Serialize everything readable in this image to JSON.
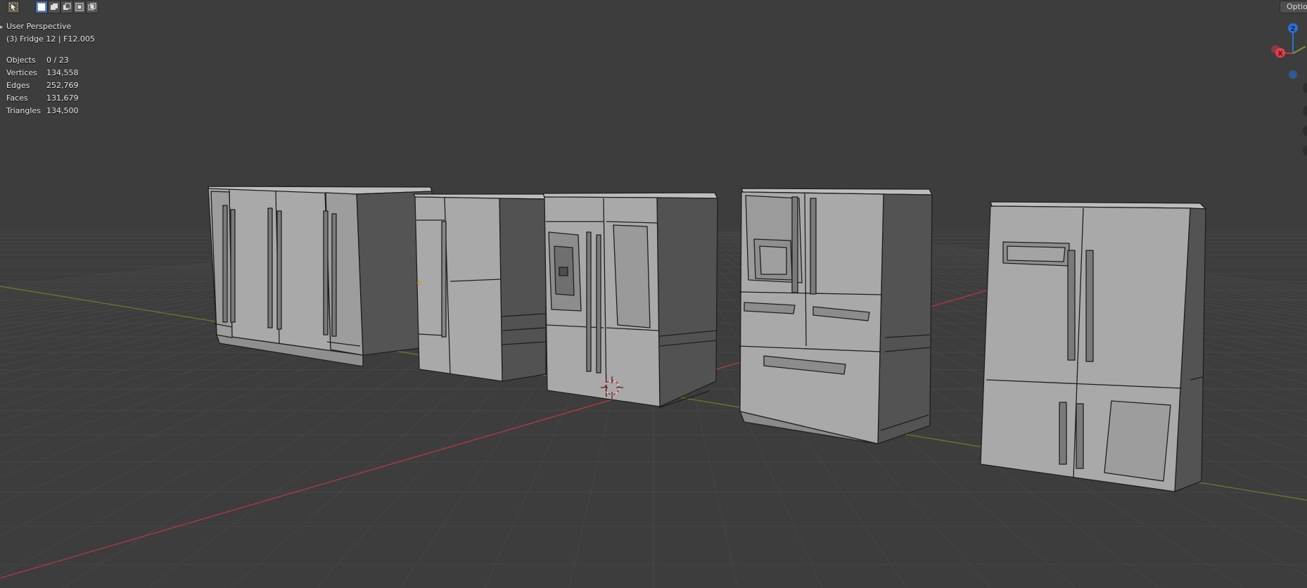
{
  "viewport": {
    "mode": "User Perspective",
    "active_object": "(3) Fridge 12 | F12.005",
    "options_label": "Options"
  },
  "stats": [
    {
      "label": "Objects",
      "value": "0 / 23"
    },
    {
      "label": "Vertices",
      "value": "134,558"
    },
    {
      "label": "Edges",
      "value": "252,769"
    },
    {
      "label": "Faces",
      "value": "131,679"
    },
    {
      "label": "Triangles",
      "value": "134,500"
    }
  ],
  "gizmo": {
    "z_label": "Z",
    "x_label": "X"
  },
  "toolbar": {
    "tools": [
      "select-tool-icon"
    ],
    "select_modes": [
      "select-new-icon",
      "select-extend-icon",
      "select-subtract-icon",
      "select-invert-icon",
      "select-intersect-icon"
    ]
  },
  "colors": {
    "background": "#3d3d3d",
    "grid": "#454545",
    "x_axis": "#b83f4d",
    "y_axis": "#6d8a2e",
    "z_axis": "#2e6ecc",
    "model_light": "#a9a9a9",
    "model_dark": "#4a4a4a",
    "accent": "#4772b3"
  }
}
